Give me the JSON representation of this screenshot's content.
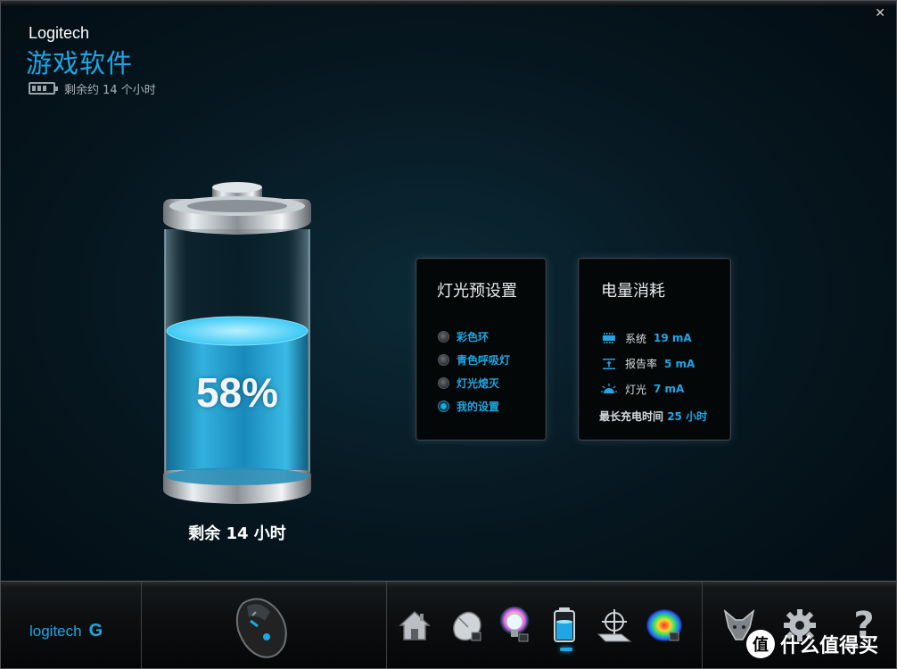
{
  "header": {
    "brand": "Logitech",
    "title": "游戏软件",
    "status": "剩余约 14 个小时"
  },
  "battery": {
    "percent": 58,
    "percent_label": "58%",
    "remaining_label": "剩余 14 小时"
  },
  "lighting_panel": {
    "title": "灯光预设置",
    "options": [
      {
        "label": "彩色环",
        "selected": false
      },
      {
        "label": "青色呼吸灯",
        "selected": false
      },
      {
        "label": "灯光熄灭",
        "selected": false
      },
      {
        "label": "我的设置",
        "selected": true
      }
    ]
  },
  "power_panel": {
    "title": "电量消耗",
    "items": [
      {
        "icon": "chip-icon",
        "label": "系统",
        "value": "19 mA"
      },
      {
        "icon": "report-rate-icon",
        "label": "报告率",
        "value": "5 mA"
      },
      {
        "icon": "light-sun-icon",
        "label": "灯光",
        "value": "7 mA"
      }
    ],
    "max_charge_label": "最长充电时间",
    "max_charge_value": "25 小时"
  },
  "footer": {
    "logo_text": "logitech",
    "toolbar": [
      {
        "name": "home-icon"
      },
      {
        "name": "mouse-buttons-icon"
      },
      {
        "name": "lighting-bulb-icon"
      },
      {
        "name": "battery-icon",
        "active": true
      },
      {
        "name": "surface-tuning-icon"
      },
      {
        "name": "heatmap-icon"
      }
    ],
    "watermark": "什么值得买"
  },
  "colors": {
    "accent": "#1ea7e4",
    "background": "#06161f"
  }
}
